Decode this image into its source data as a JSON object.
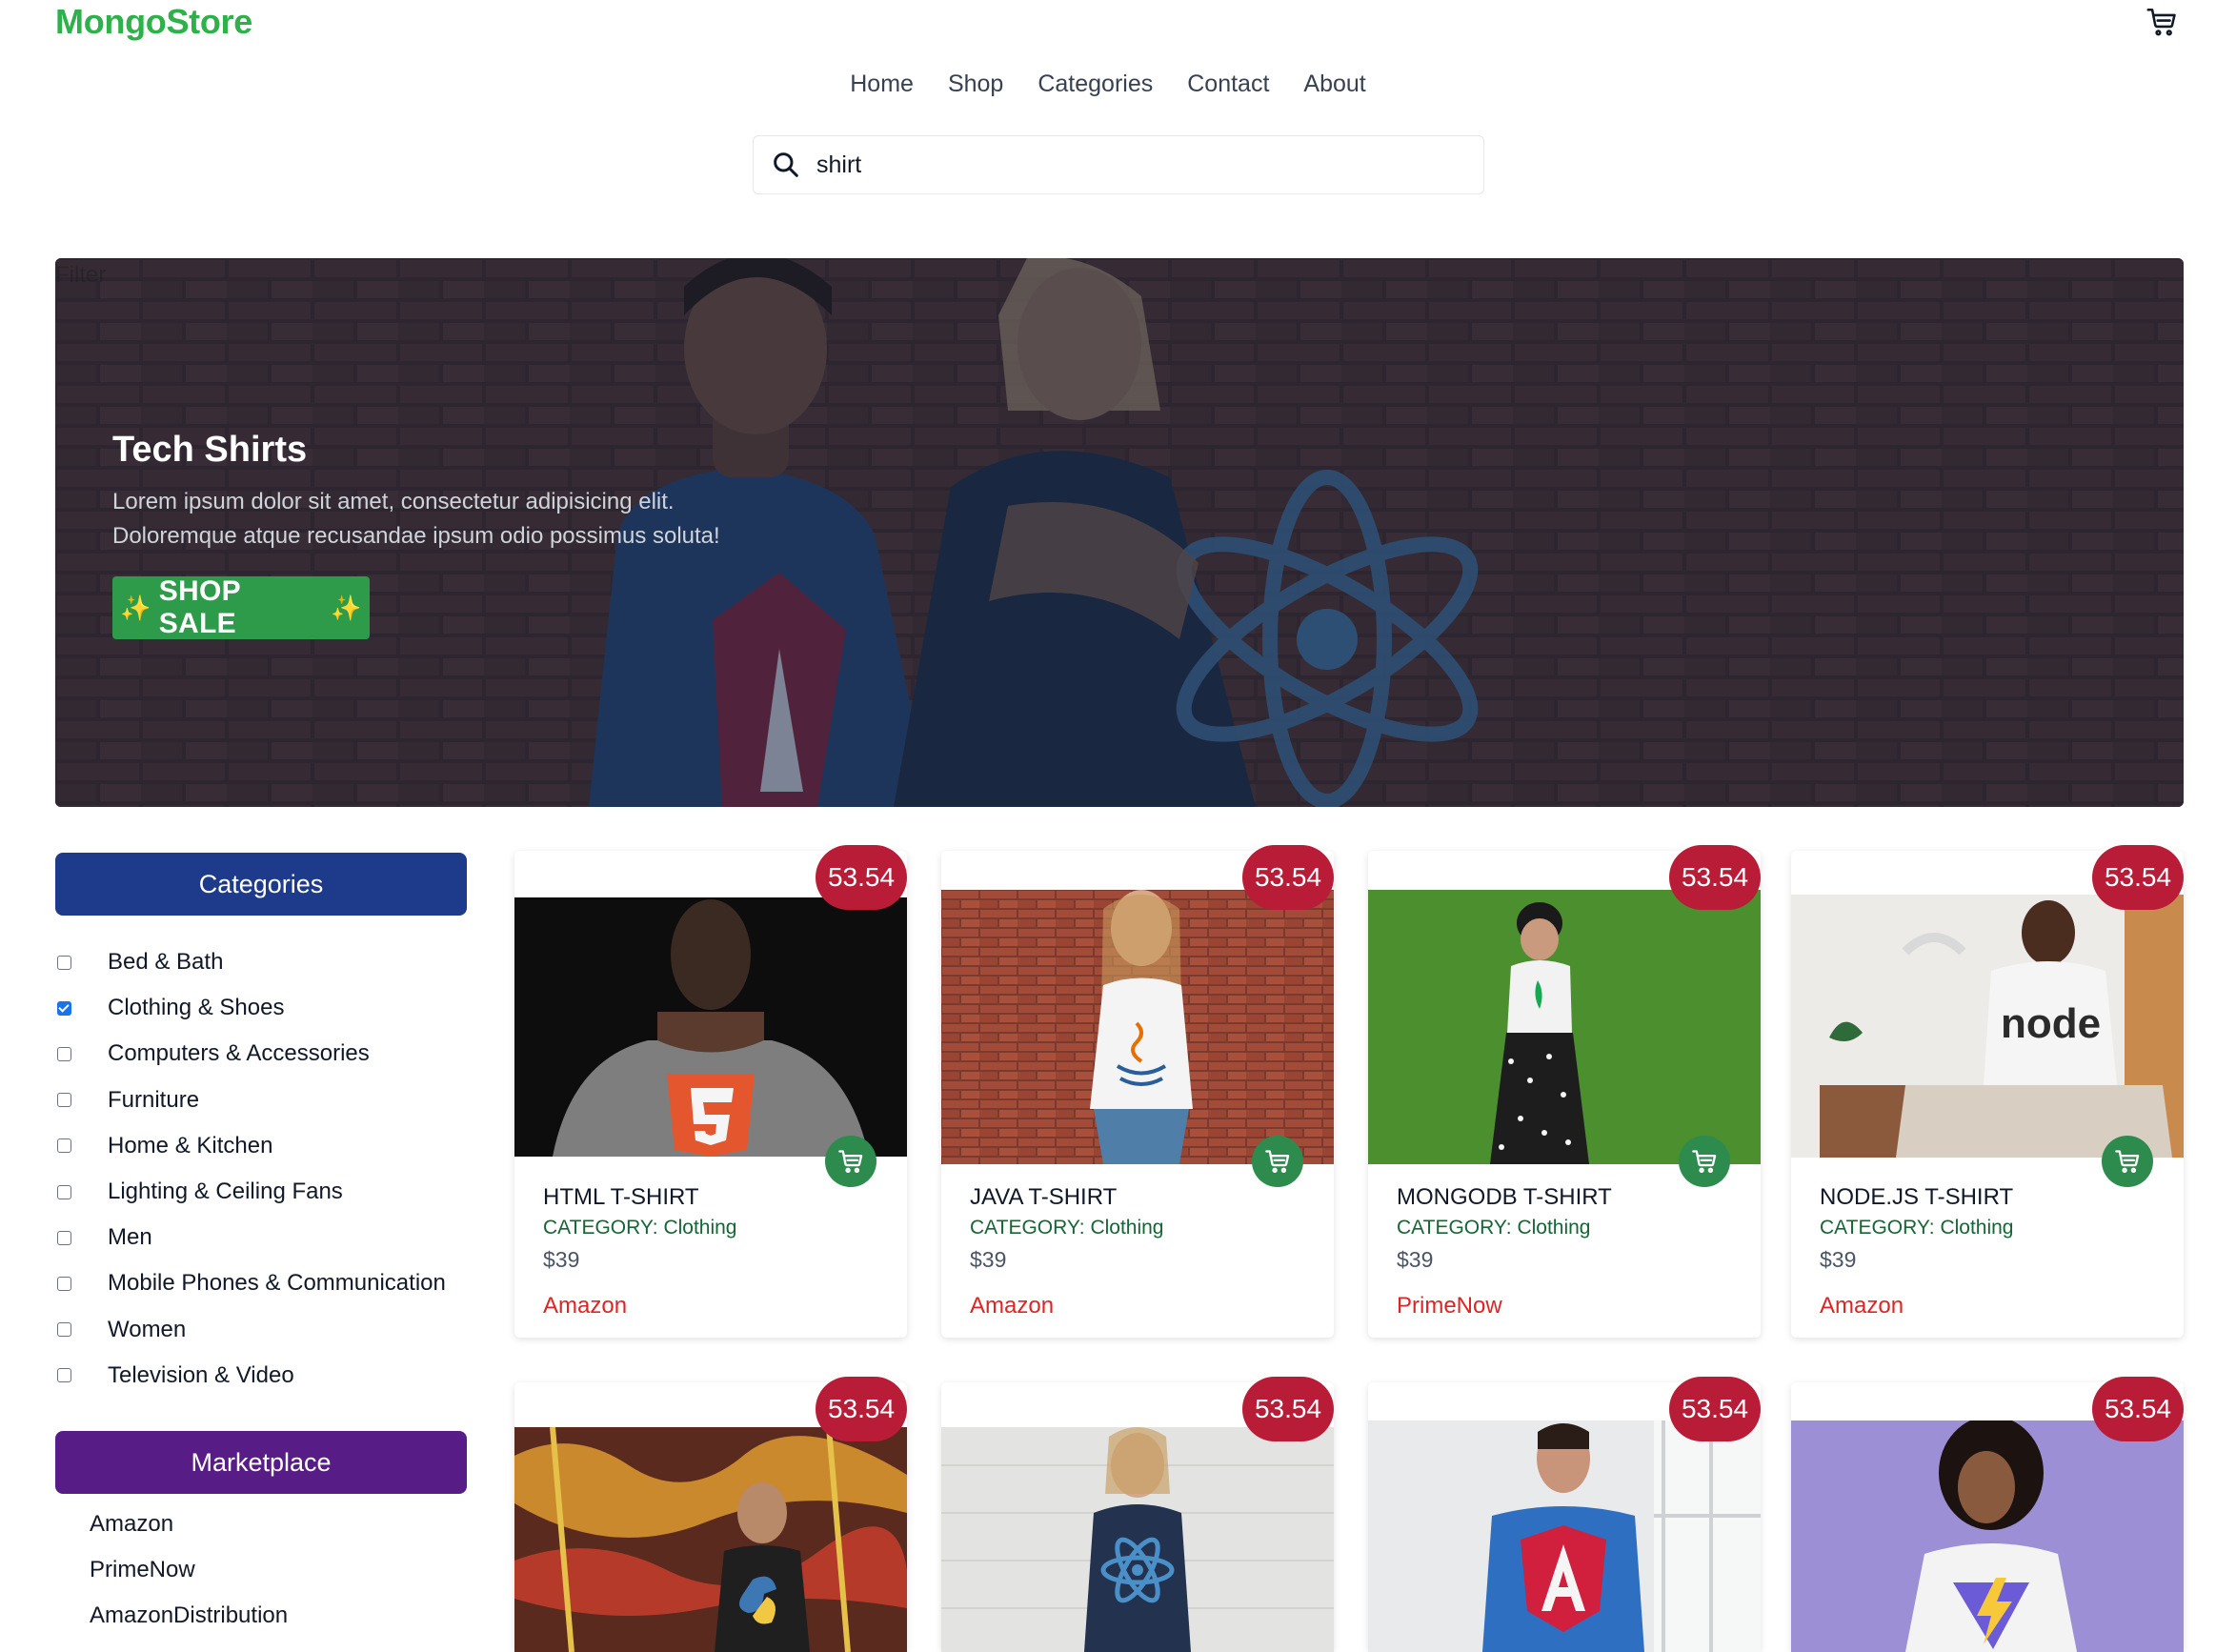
{
  "brand": "MongoStore",
  "nav": [
    "Home",
    "Shop",
    "Categories",
    "Contact",
    "About"
  ],
  "search": {
    "value": "shirt"
  },
  "hero": {
    "filter_label": "Filter",
    "title": "Tech Shirts",
    "text_line1": "Lorem ipsum dolor sit amet, consectetur adipisicing elit.",
    "text_line2": "Doloremque atque recusandae ipsum odio possimus soluta!",
    "button": "SHOP SALE",
    "button_spark": "✨"
  },
  "sidebar": {
    "categories_title": "Categories",
    "categories": [
      {
        "label": "Bed & Bath",
        "checked": false
      },
      {
        "label": "Clothing & Shoes",
        "checked": true
      },
      {
        "label": "Computers & Accessories",
        "checked": false
      },
      {
        "label": "Furniture",
        "checked": false
      },
      {
        "label": "Home & Kitchen",
        "checked": false
      },
      {
        "label": "Lighting & Ceiling Fans",
        "checked": false
      },
      {
        "label": "Men",
        "checked": false
      },
      {
        "label": "Mobile Phones & Communication",
        "checked": false
      },
      {
        "label": "Women",
        "checked": false
      },
      {
        "label": "Television & Video",
        "checked": false
      }
    ],
    "marketplace_title": "Marketplace",
    "marketplace": [
      "Amazon",
      "PrimeNow",
      "AmazonDistribution"
    ]
  },
  "products": [
    {
      "name": "HTML T-SHIRT",
      "category_label": "CATEGORY:",
      "category": "Clothing",
      "price": "$39",
      "store": "Amazon",
      "badge": "53.54"
    },
    {
      "name": "JAVA T-SHIRT",
      "category_label": "CATEGORY:",
      "category": "Clothing",
      "price": "$39",
      "store": "Amazon",
      "badge": "53.54"
    },
    {
      "name": "MONGODB T-SHIRT",
      "category_label": "CATEGORY:",
      "category": "Clothing",
      "price": "$39",
      "store": "PrimeNow",
      "badge": "53.54"
    },
    {
      "name": "NODE.JS T-SHIRT",
      "category_label": "CATEGORY:",
      "category": "Clothing",
      "price": "$39",
      "store": "Amazon",
      "badge": "53.54"
    },
    {
      "badge": "53.54"
    },
    {
      "badge": "53.54"
    },
    {
      "badge": "53.54"
    },
    {
      "badge": "53.54"
    }
  ],
  "colors": {
    "brand_green": "#2eb14b",
    "badge_red": "#b91c37",
    "categories_blue": "#1e3a8a",
    "marketplace_purple": "#581c87",
    "cart_green": "#2d8b4e",
    "store_red": "#dc2626"
  }
}
